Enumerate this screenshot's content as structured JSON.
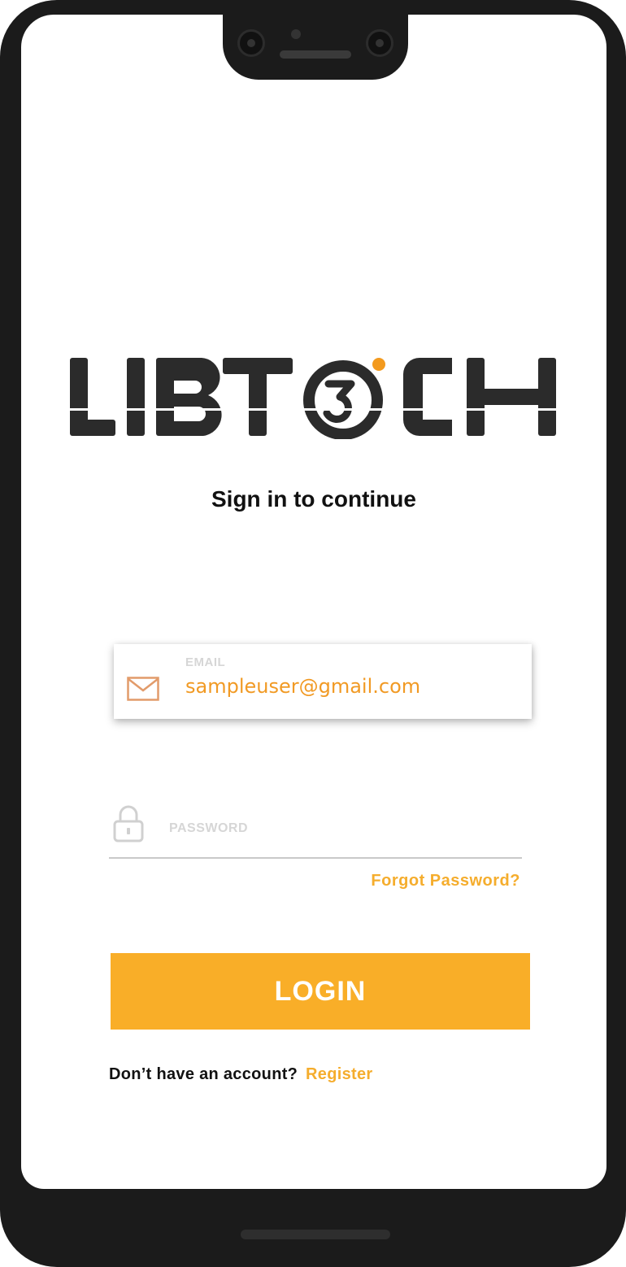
{
  "brand": {
    "logo_text": "LIBTECH",
    "accent_color": "#f9ae28",
    "logo_dot_color": "#f39a1e"
  },
  "header": {
    "subtitle": "Sign in to continue"
  },
  "email": {
    "label": "EMAIL",
    "value": "sampleuser@gmail.com",
    "icon": "mail-icon"
  },
  "password": {
    "placeholder": "PASSWORD",
    "value": "",
    "icon": "lock-icon"
  },
  "links": {
    "forgot_password": "Forgot Password?",
    "no_account_text": "Don’t have an account?",
    "register": "Register"
  },
  "buttons": {
    "login": "LOGIN"
  }
}
